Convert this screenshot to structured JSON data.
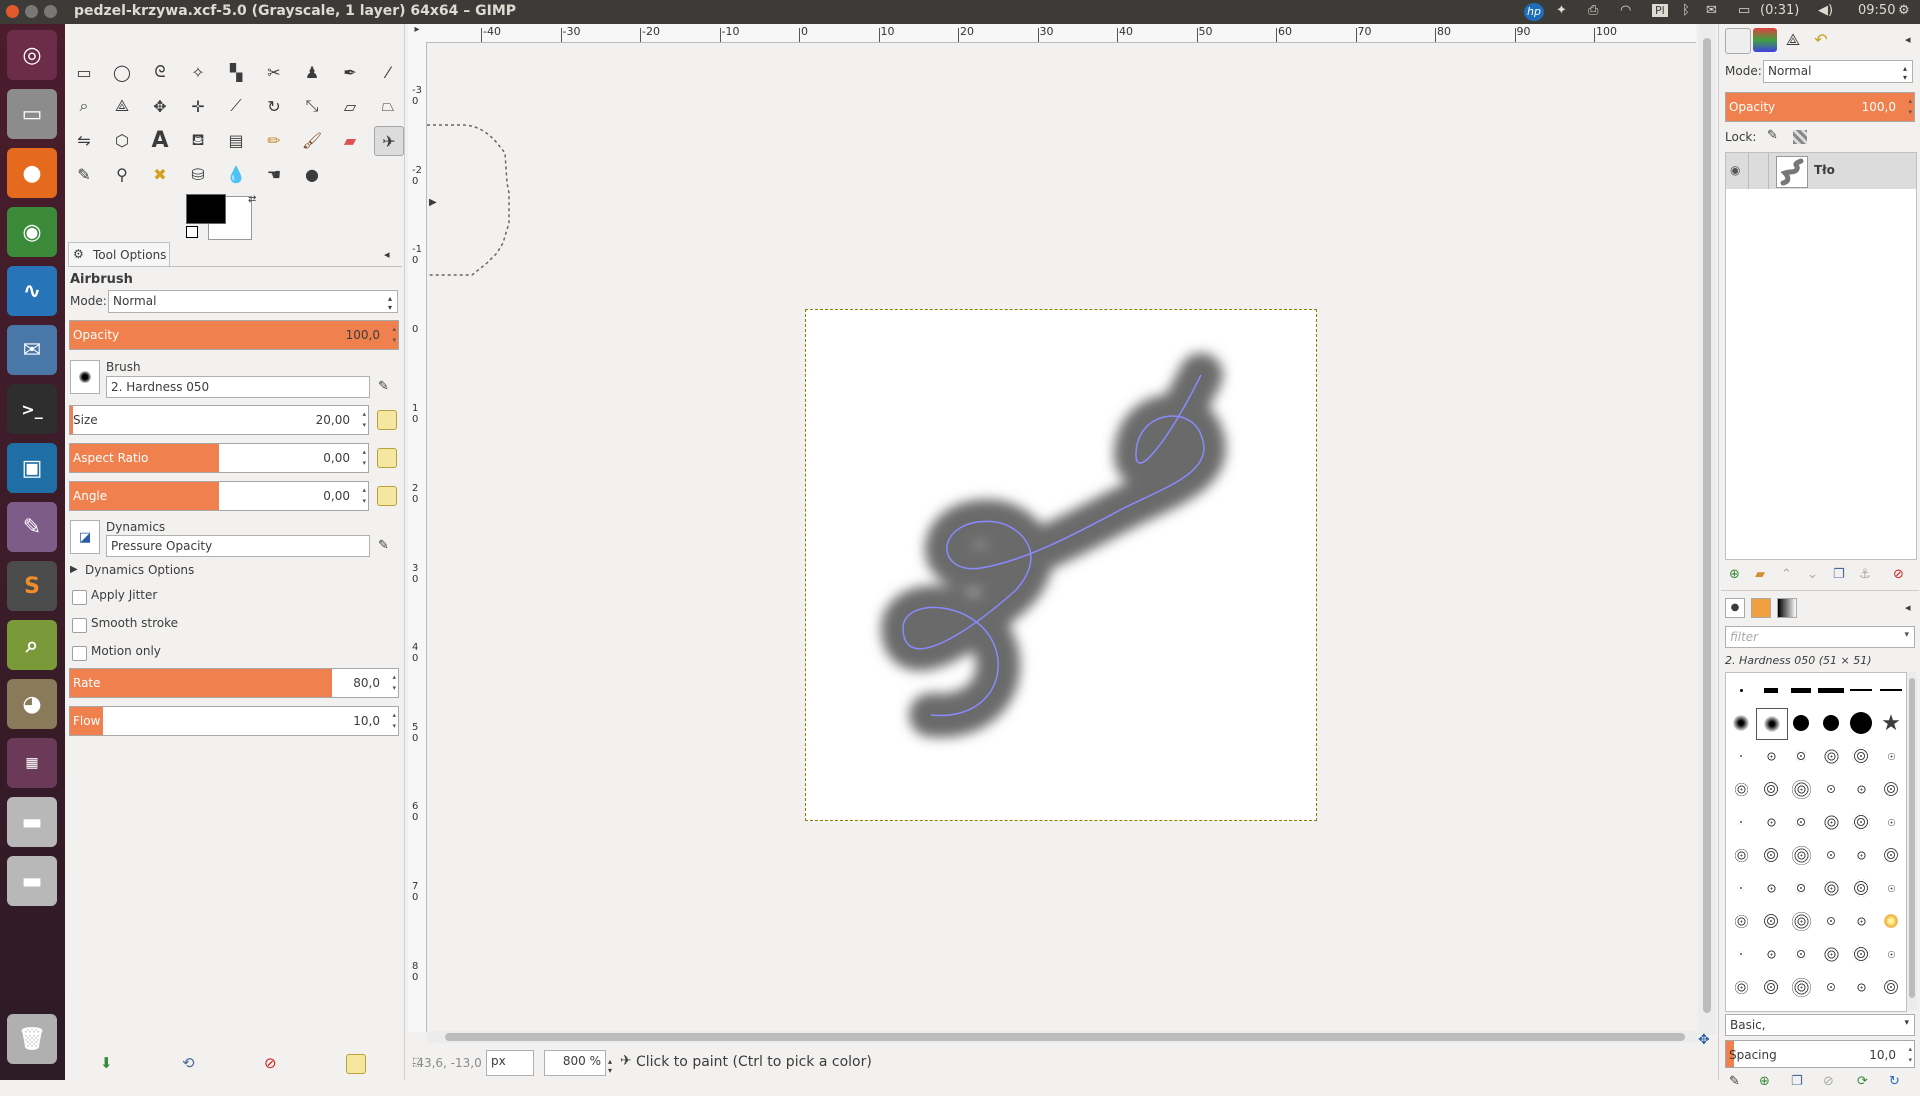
{
  "window": {
    "title": "pedzel-krzywa.xcf-5.0 (Grayscale, 1 layer) 64x64 – GIMP",
    "keyboard": "Pl",
    "battery": "(0:31)",
    "clock": "09:50"
  },
  "launcher": {
    "items": [
      "ubuntu-dash",
      "files",
      "firefox",
      "chrome",
      "system-monitor",
      "thunderbird",
      "terminal",
      "software",
      "settings",
      "sublime-text",
      "image-viewer",
      "gimp",
      "workspaces",
      "drive-1",
      "drive-2",
      "trash"
    ]
  },
  "toolbox": {
    "tools": [
      "rect-select",
      "ellipse-select",
      "free-select",
      "fuzzy-select",
      "select-by-color",
      "scissors",
      "foreground-select",
      "paths",
      "color-picker",
      "zoom",
      "measure",
      "move",
      "align",
      "crop",
      "rotate",
      "scale",
      "shear",
      "perspective",
      "flip",
      "cage",
      "warp",
      "text",
      "bucket-fill",
      "blend",
      "pencil",
      "paintbrush",
      "eraser",
      "airbrush",
      "ink",
      "clone",
      "heal",
      "perspective-clone",
      "blur",
      "smudge",
      "dodge-burn"
    ]
  },
  "tool_options": {
    "tab_label": "Tool Options",
    "tool_name": "Airbrush",
    "mode_label": "Mode:",
    "mode_value": "Normal",
    "opacity": {
      "label": "Opacity",
      "value": "100,0",
      "fraction": 1.0
    },
    "brush_label": "Brush",
    "brush_value": "2. Hardness 050",
    "size": {
      "label": "Size",
      "value": "20,00",
      "fraction": 0.01
    },
    "aspect_ratio": {
      "label": "Aspect Ratio",
      "value": "0,00",
      "fraction": 0.5
    },
    "angle": {
      "label": "Angle",
      "value": "0,00",
      "fraction": 0.5
    },
    "dynamics_label": "Dynamics",
    "dynamics_value": "Pressure Opacity",
    "dynamics_options": "Dynamics Options",
    "apply_jitter": "Apply Jitter",
    "smooth_stroke": "Smooth stroke",
    "motion_only": "Motion only",
    "rate": {
      "label": "Rate",
      "value": "80,0",
      "fraction": 0.8
    },
    "flow": {
      "label": "Flow",
      "value": "10,0",
      "fraction": 0.1
    }
  },
  "ruler": {
    "h_ticks": [
      "-40",
      "-30",
      "-20",
      "-10",
      "0",
      "10",
      "20",
      "30",
      "40",
      "50",
      "60",
      "70",
      "80",
      "90",
      "100"
    ],
    "v_ticks": [
      "-3\n0",
      "-2\n0",
      "-1\n0",
      "0",
      "1\n0",
      "2\n0",
      "3\n0",
      "4\n0",
      "5\n0",
      "6\n0",
      "7\n0",
      "8\n0"
    ]
  },
  "status": {
    "coords": "-43,6, -13,0",
    "unit": "px",
    "zoom": "800 %",
    "message": "Click to paint (Ctrl to pick a color)"
  },
  "layers": {
    "mode_label": "Mode:",
    "mode_value": "Normal",
    "opacity_label": "Opacity",
    "opacity_value": "100,0",
    "lock_label": "Lock:",
    "layer_name": "Tło"
  },
  "brushes": {
    "filter_placeholder": "filter",
    "current": "2. Hardness 050 (51 × 51)",
    "tag": "Basic,",
    "spacing_label": "Spacing",
    "spacing_value": "10,0"
  },
  "colors": {
    "accent": "#f0814e",
    "launcher_bg": "#4a1c2c",
    "topbar_bg": "#3c3b37"
  }
}
